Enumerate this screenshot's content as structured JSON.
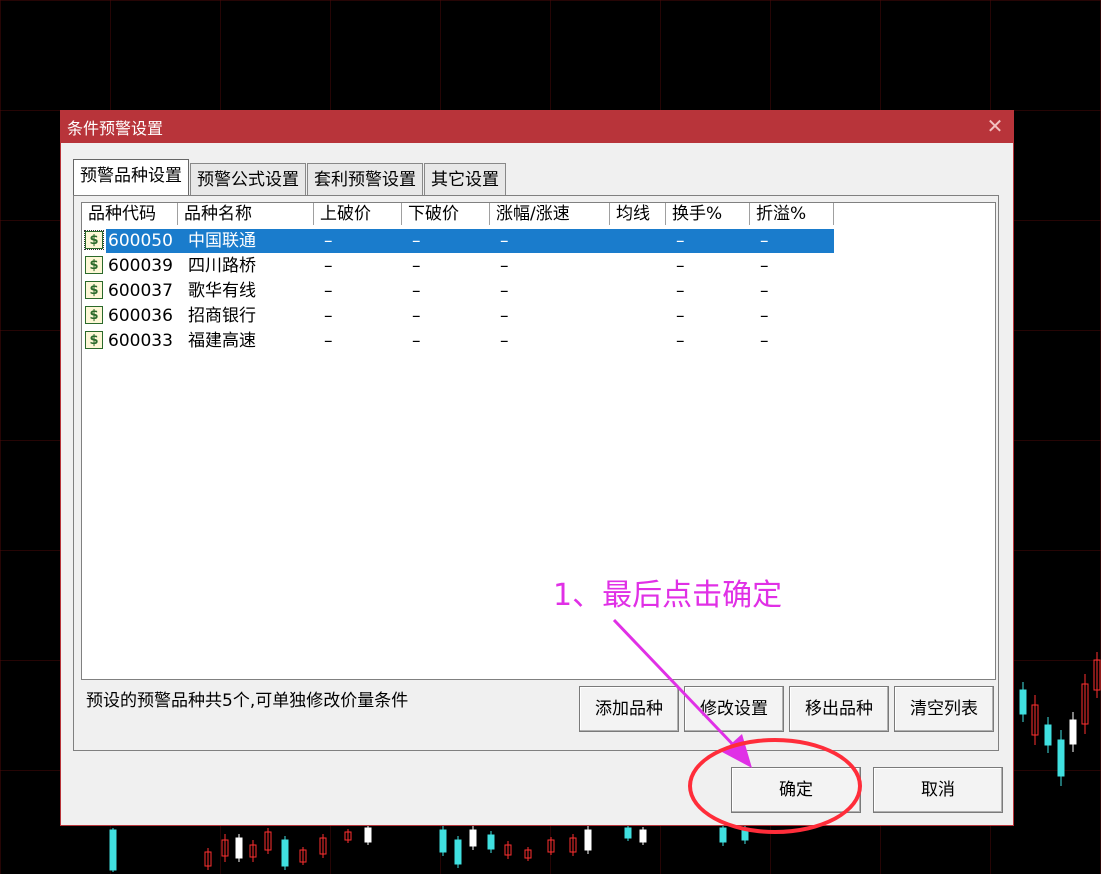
{
  "dialog": {
    "title": "条件预警设置",
    "close_glyph": "✕",
    "tabs": [
      {
        "label": "预警品种设置",
        "active": true
      },
      {
        "label": "预警公式设置",
        "active": false
      },
      {
        "label": "套利预警设置",
        "active": false
      },
      {
        "label": "其它设置",
        "active": false
      }
    ],
    "list": {
      "columns": [
        "品种代码",
        "品种名称",
        "上破价",
        "下破价",
        "涨幅/涨速",
        "均线",
        "换手%",
        "折溢%"
      ],
      "rows": [
        {
          "code": "600050",
          "name": "中国联通",
          "up": "–",
          "down": "–",
          "chg": "–",
          "ma": "",
          "turnover": "–",
          "premium": "–",
          "selected": true
        },
        {
          "code": "600039",
          "name": "四川路桥",
          "up": "–",
          "down": "–",
          "chg": "–",
          "ma": "",
          "turnover": "–",
          "premium": "–",
          "selected": false
        },
        {
          "code": "600037",
          "name": "歌华有线",
          "up": "–",
          "down": "–",
          "chg": "–",
          "ma": "",
          "turnover": "–",
          "premium": "–",
          "selected": false
        },
        {
          "code": "600036",
          "name": "招商银行",
          "up": "–",
          "down": "–",
          "chg": "–",
          "ma": "",
          "turnover": "–",
          "premium": "–",
          "selected": false
        },
        {
          "code": "600033",
          "name": "福建高速",
          "up": "–",
          "down": "–",
          "chg": "–",
          "ma": "",
          "turnover": "–",
          "premium": "–",
          "selected": false
        }
      ],
      "row_icon": "$"
    },
    "summary": "预设的预警品种共5个,可单独修改价量条件",
    "buttons": {
      "add": "添加品种",
      "modify": "修改设置",
      "remove": "移出品种",
      "clear": "清空列表",
      "ok": "确定",
      "cancel": "取消"
    }
  },
  "annotation": {
    "text": "1、最后点击确定",
    "color": "#e030e6",
    "circle_color": "#ff2d3a"
  },
  "colors": {
    "titlebar": "#b8343a",
    "selection": "#1a7ccc"
  }
}
